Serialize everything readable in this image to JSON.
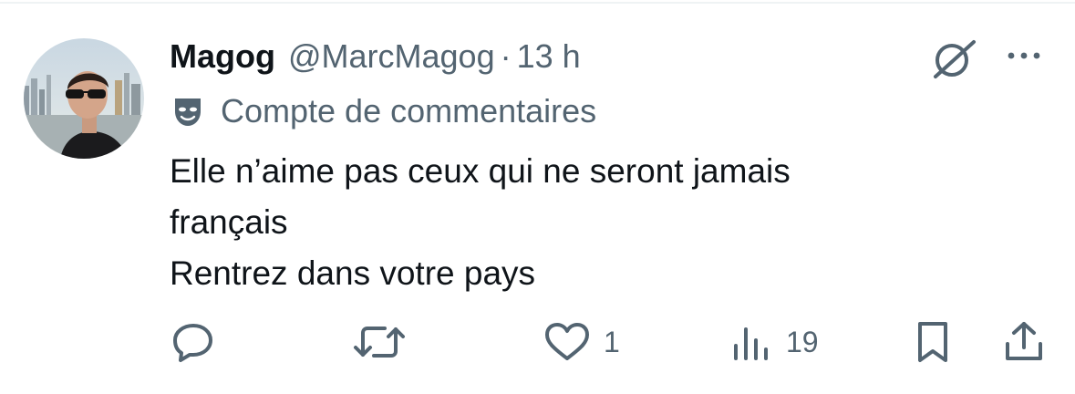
{
  "tweet": {
    "author_name": "Magog",
    "author_handle": "@MarcMagog",
    "separator": "·",
    "timestamp": "13 h",
    "account_label": "Compte de commentaires",
    "text_lines": [
      "Elle n’aime pas ceux qui ne seront jamais",
      "français",
      "Rentrez dans votre pays"
    ]
  },
  "actions": {
    "reply": {
      "icon": "reply-icon"
    },
    "repost": {
      "icon": "repost-icon"
    },
    "like": {
      "icon": "heart-icon",
      "count": "1"
    },
    "views": {
      "icon": "views-icon",
      "count": "19"
    },
    "bookmark": {
      "icon": "bookmark-icon"
    },
    "share": {
      "icon": "share-icon"
    }
  },
  "colors": {
    "text_primary": "#0f1419",
    "text_secondary": "#536471",
    "divider": "#eff3f4"
  }
}
